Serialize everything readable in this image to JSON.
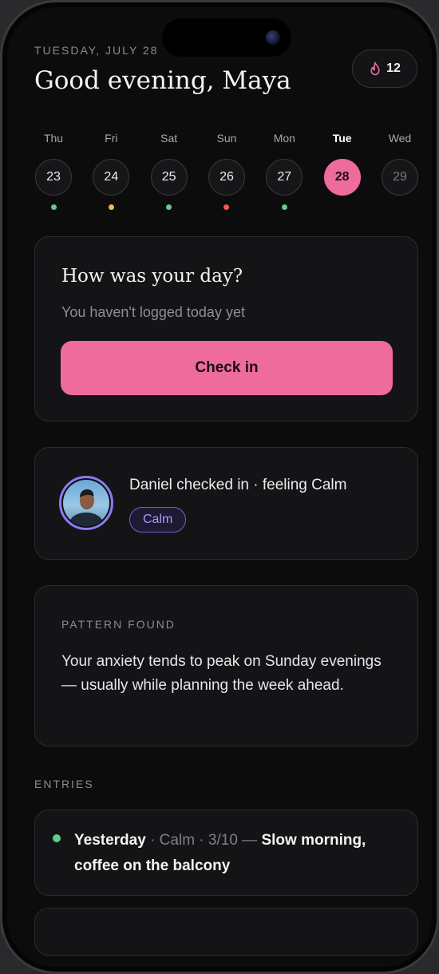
{
  "header": {
    "date": "TUESDAY, JULY 28",
    "greeting": "Good evening, Maya",
    "streak_count": "12",
    "streak_icon": "flame-icon"
  },
  "week": [
    {
      "day": "Thu",
      "date": "23",
      "mood_color": "#5fce86"
    },
    {
      "day": "Fri",
      "date": "24",
      "mood_color": "#f2b84b"
    },
    {
      "day": "Sat",
      "date": "25",
      "mood_color": "#5fce86"
    },
    {
      "day": "Sun",
      "date": "26",
      "mood_color": "#ef5a5a"
    },
    {
      "day": "Mon",
      "date": "27",
      "mood_color": "#5fce86"
    },
    {
      "day": "Tue",
      "date": "28",
      "mood_color": null,
      "today": true
    },
    {
      "day": "Wed",
      "date": "29",
      "mood_color": null,
      "future": true
    }
  ],
  "checkin_card": {
    "title": "How was your day?",
    "subtitle": "You haven't logged today yet",
    "button_label": "Check in"
  },
  "partner_card": {
    "text": "Daniel checked in · feeling Calm",
    "mood": "Calm"
  },
  "pattern_card": {
    "label": "PATTERN FOUND",
    "text": "Your anxiety tends to peak on Sunday evenings — usually while planning the week ahead."
  },
  "entries": {
    "label": "ENTRIES",
    "items": [
      {
        "when": "Yesterday",
        "mood_meta": " · Calm · 3/10 — ",
        "note": "Slow morning, coffee on the balcony",
        "dot_color": "#5fce86"
      }
    ]
  },
  "colors": {
    "accent": "#ee6b9c",
    "partner_accent": "#8b7cf0",
    "background": "#0c0c0d",
    "card": "#141416"
  }
}
